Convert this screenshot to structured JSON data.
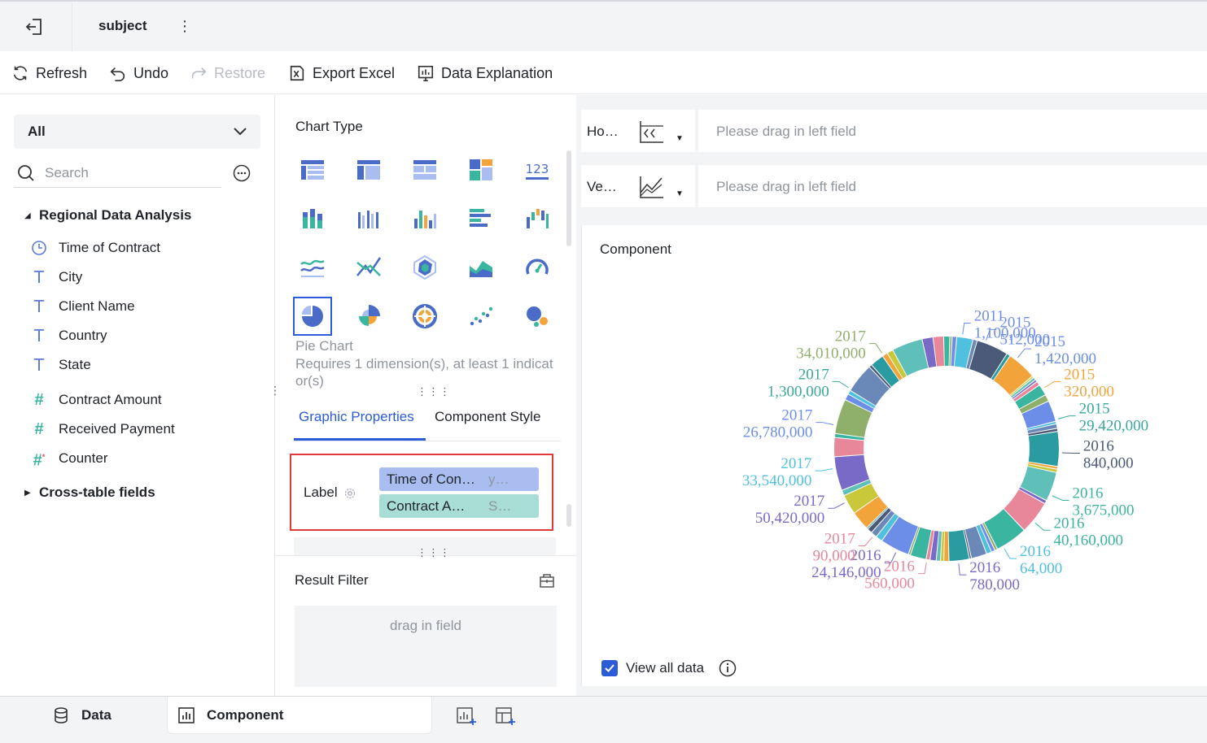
{
  "header": {
    "title": "subject",
    "exit_icon": "exit-icon",
    "more_icon": "more-vertical-icon"
  },
  "toolbar": {
    "refresh": "Refresh",
    "undo": "Undo",
    "restore": "Restore",
    "export_excel": "Export Excel",
    "data_explanation": "Data Explanation"
  },
  "left": {
    "select_value": "All",
    "search_placeholder": "Search",
    "group1": "Regional Data Analysis",
    "fields": [
      {
        "type": "date",
        "label": "Time of Contract"
      },
      {
        "type": "text",
        "label": "City"
      },
      {
        "type": "text",
        "label": "Client Name"
      },
      {
        "type": "text",
        "label": "Country"
      },
      {
        "type": "text",
        "label": "State"
      },
      {
        "type": "number",
        "label": "Contract Amount"
      },
      {
        "type": "number",
        "label": "Received Payment"
      },
      {
        "type": "number-calc",
        "label": "Counter"
      }
    ],
    "group2": "Cross-table fields"
  },
  "middle": {
    "chart_type_title": "Chart Type",
    "icon_123": "123",
    "selected_chart": "Pie Chart",
    "requirement": "Requires 1 dimension(s), at least 1 indicator(s)",
    "tabs": [
      "Graphic Properties",
      "Component Style"
    ],
    "label_title": "Label",
    "label_fields": [
      {
        "name": "Time of Con…",
        "sub": "y…"
      },
      {
        "name": "Contract A…",
        "sub": "S…"
      }
    ],
    "result_filter": "Result Filter",
    "drag_field": "drag in field"
  },
  "right": {
    "horizontal_label": "Ho…",
    "vertical_label": "Ve…",
    "drop_placeholder": "Please drag in left field",
    "component_title": "Component",
    "view_all": "View all data"
  },
  "bottom": {
    "data_tab": "Data",
    "component_tab": "Component"
  },
  "chart_data": {
    "type": "pie",
    "donut": true,
    "title": "",
    "labels": [
      {
        "year": "2011",
        "value": "1,100,000",
        "color": "#6d8ee8"
      },
      {
        "year": "2015",
        "value": "512,000",
        "color": "#6d8ee8"
      },
      {
        "year": "2015",
        "value": "1,420,000",
        "color": "#6d8ee8"
      },
      {
        "year": "2015",
        "value": "320,000",
        "color": "#f2a33a"
      },
      {
        "year": "2015",
        "value": "29,420,000",
        "color": "#3aa89a"
      },
      {
        "year": "2016",
        "value": "840,000",
        "color": "#4a5a78"
      },
      {
        "year": "2016",
        "value": "3,675,000",
        "color": "#3ab5a0"
      },
      {
        "year": "2016",
        "value": "40,160,000",
        "color": "#3ab5a0"
      },
      {
        "year": "2016",
        "value": "64,000",
        "color": "#4fc0e0"
      },
      {
        "year": "2016",
        "value": "780,000",
        "color": "#7a6ac8"
      },
      {
        "year": "2016",
        "value": "560,000",
        "color": "#e8879a"
      },
      {
        "year": "2016",
        "value": "24,146,000",
        "color": "#7a6ac8"
      },
      {
        "year": "2017",
        "value": "90,000",
        "color": "#e8879a"
      },
      {
        "year": "2017",
        "value": "50,420,000",
        "color": "#7a6ac8"
      },
      {
        "year": "2017",
        "value": "33,540,000",
        "color": "#4fc0e0"
      },
      {
        "year": "2017",
        "value": "26,780,000",
        "color": "#6d8ee8"
      },
      {
        "year": "2017",
        "value": "1,300,000",
        "color": "#3aa89a"
      },
      {
        "year": "2017",
        "value": "34,010,000",
        "color": "#8fb06a"
      }
    ],
    "slice_colors": [
      "#6d8ee8",
      "#f2a33a",
      "#3ab5a0",
      "#4a5a78",
      "#7a6ac8",
      "#4fc0e0",
      "#c8c83a",
      "#8fb06a",
      "#2a9ba0",
      "#e8879a",
      "#6a88b8",
      "#5ec0b8"
    ]
  }
}
